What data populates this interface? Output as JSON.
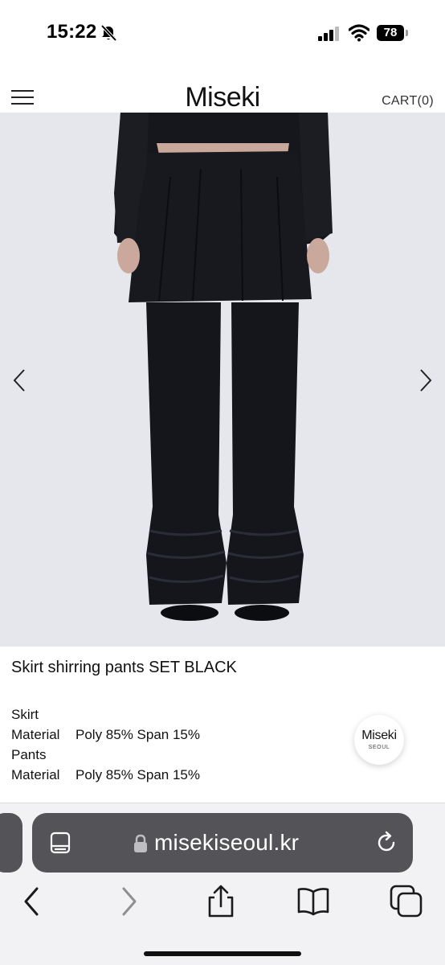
{
  "status_bar": {
    "time": "15:22",
    "battery_level": "78",
    "icons": [
      "bell-off-icon",
      "cellular-signal-icon",
      "wifi-icon",
      "battery-icon"
    ]
  },
  "header": {
    "logo": "Miseki",
    "cart_label": "CART(0)",
    "menu_icon": "hamburger-menu-icon"
  },
  "product": {
    "title": "Skirt shirring pants SET BLACK",
    "details": [
      {
        "label": "Skirt",
        "value": ""
      },
      {
        "label": "Material",
        "value": "Poly 85% Span 15%"
      },
      {
        "label": "Pants",
        "value": ""
      },
      {
        "label": "Material",
        "value": "Poly 85% Span 15%"
      }
    ],
    "image_nav": [
      "chevron-left-icon",
      "chevron-right-icon"
    ]
  },
  "floating_badge": {
    "name": "Miseki",
    "sub": "SEOUL"
  },
  "browser": {
    "url": "misekiseoul.kr",
    "toolbar": [
      "back-icon",
      "forward-icon",
      "share-icon",
      "bookmarks-icon",
      "tabs-icon"
    ]
  },
  "colors": {
    "image_background": "#e6e7ed",
    "garment": "#15171c",
    "address_bar": "#545458",
    "chrome_background": "#f2f2f4"
  }
}
